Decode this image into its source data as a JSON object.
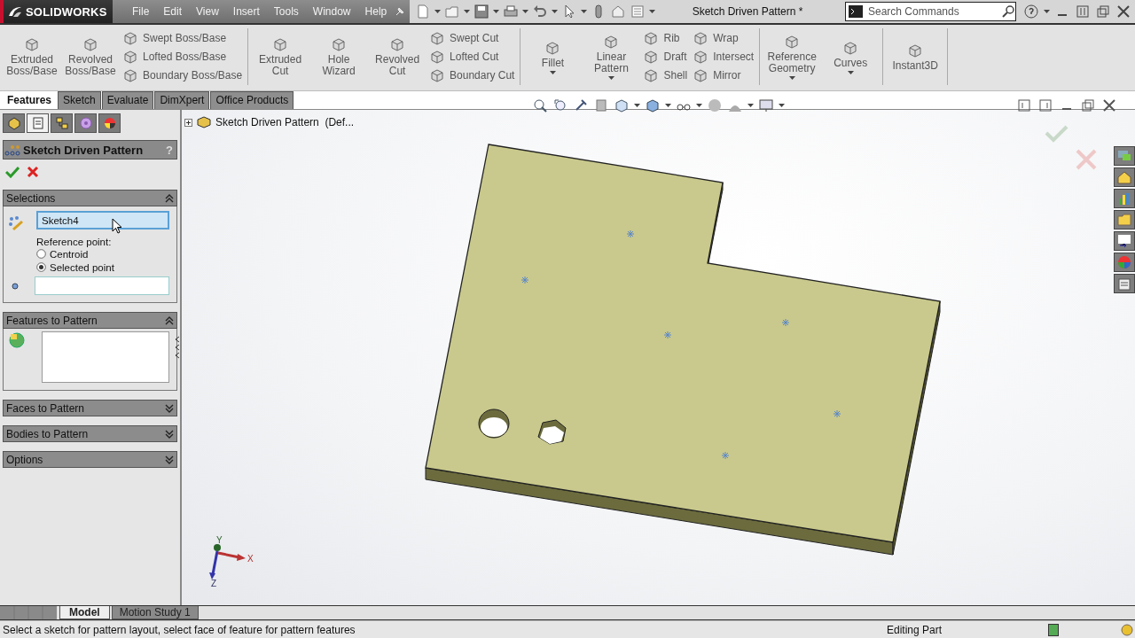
{
  "title_bar": {
    "brand": "SOLIDWORKS",
    "menu": [
      "File",
      "Edit",
      "View",
      "Insert",
      "Tools",
      "Window",
      "Help"
    ],
    "document_title": "Sketch Driven Pattern *",
    "search": {
      "placeholder": "Search Commands"
    }
  },
  "ribbon": {
    "groups": [
      {
        "items": [
          {
            "kind": "large",
            "label": "Extruded Boss/Base",
            "dropdown": false
          },
          {
            "kind": "large",
            "label": "Revolved Boss/Base",
            "dropdown": false
          },
          {
            "kind": "stack",
            "items": [
              "Swept Boss/Base",
              "Lofted Boss/Base",
              "Boundary Boss/Base"
            ]
          }
        ]
      },
      {
        "items": [
          {
            "kind": "large",
            "label": "Extruded Cut",
            "dropdown": false
          },
          {
            "kind": "large",
            "label": "Hole Wizard",
            "dropdown": false
          },
          {
            "kind": "large",
            "label": "Revolved Cut",
            "dropdown": false
          },
          {
            "kind": "stack",
            "items": [
              "Swept Cut",
              "Lofted Cut",
              "Boundary Cut"
            ]
          }
        ]
      },
      {
        "items": [
          {
            "kind": "large",
            "label": "Fillet",
            "dropdown": true
          },
          {
            "kind": "large",
            "label": "Linear Pattern",
            "dropdown": true
          },
          {
            "kind": "stack",
            "items": [
              "Rib",
              "Draft",
              "Shell"
            ]
          },
          {
            "kind": "stack",
            "items": [
              "Wrap",
              "Intersect",
              "Mirror"
            ]
          }
        ]
      },
      {
        "items": [
          {
            "kind": "large",
            "label": "Reference Geometry",
            "dropdown": true
          },
          {
            "kind": "large",
            "label": "Curves",
            "dropdown": true
          }
        ]
      },
      {
        "items": [
          {
            "kind": "large",
            "label": "Instant3D",
            "dropdown": false
          }
        ]
      }
    ]
  },
  "command_tabs": [
    {
      "label": "Features",
      "selected": true
    },
    {
      "label": "Sketch",
      "selected": false
    },
    {
      "label": "Evaluate",
      "selected": false
    },
    {
      "label": "DimXpert",
      "selected": false
    },
    {
      "label": "Office Products",
      "selected": false
    }
  ],
  "manager_tabs": [
    {
      "selected": false
    },
    {
      "selected": true
    },
    {
      "selected": false
    },
    {
      "selected": false
    },
    {
      "selected": false
    }
  ],
  "property_manager": {
    "title": "Sketch Driven Pattern",
    "help": "?",
    "sections": [
      {
        "kind": "selections",
        "title": "Selections",
        "expanded": true,
        "sketch_value": "Sketch4",
        "reference_label": "Reference point:",
        "options": [
          {
            "label": "Centroid",
            "selected": false
          },
          {
            "label": "Selected point",
            "selected": true
          }
        ]
      },
      {
        "kind": "list",
        "title": "Features to Pattern",
        "expanded": true
      },
      {
        "title": "Faces to Pattern",
        "expanded": false
      },
      {
        "title": "Bodies to Pattern",
        "expanded": false
      },
      {
        "title": "Options",
        "expanded": false
      }
    ]
  },
  "viewport": {
    "tree_item": "Sketch Driven Pattern  (Def...",
    "axes": [
      {
        "label": "X"
      },
      {
        "label": "Y"
      },
      {
        "label": "Z"
      }
    ]
  },
  "bottom_tabs": [
    {
      "label": "Model",
      "selected": true
    },
    {
      "label": "Motion Study 1",
      "selected": false
    }
  ],
  "status_bar": {
    "message": "Select a sketch for pattern layout, select face of feature for pattern features",
    "mode": "Editing Part"
  }
}
